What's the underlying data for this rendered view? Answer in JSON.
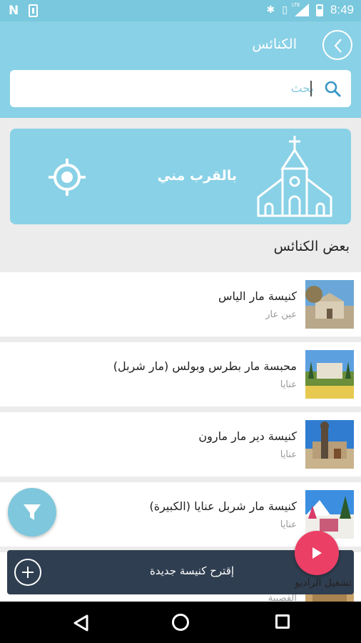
{
  "status_bar": {
    "left_icons": [
      "n-icon",
      "download-box-icon"
    ],
    "right_icons": [
      "bluetooth-icon",
      "vibrate-icon",
      "lte-signal-icon",
      "battery-icon"
    ],
    "lte_label": "LTE",
    "time": "8:49"
  },
  "header": {
    "title": "الكنائس",
    "back_icon": "chevron-right-icon",
    "search": {
      "placeholder": "بحث",
      "icon": "search-icon"
    }
  },
  "near_me": {
    "label": "بالقرب مني",
    "locate_icon": "crosshair-icon",
    "church_icon": "church-icon"
  },
  "section_title": "بعض الكنائس",
  "churches": [
    {
      "name": "كنيسة مار الياس",
      "location": "عين عار"
    },
    {
      "name": "محبسة مار بطرس وبولس (مار شربل)",
      "location": "عنايا"
    },
    {
      "name": "كنيسة دير مار مارون",
      "location": "عنايا"
    },
    {
      "name": "كنيسة مار شربل عنايا (الكبيرة)",
      "location": "عنايا"
    }
  ],
  "peek_item_location": "القصيبة",
  "filter_icon": "filter-icon",
  "suggest": {
    "label": "إقترح كنيسة جديدة",
    "icon": "add-circle-icon"
  },
  "radio": {
    "label": "تشغيل الراديو",
    "icon": "play-icon"
  },
  "colors": {
    "header": "#89d1e6",
    "status_bar": "#79c8dd",
    "suggest_bar": "#2f3e50",
    "radio_button": "#ec3f66",
    "background": "#ececec"
  },
  "nav_bar": [
    "back-icon",
    "home-icon",
    "recents-icon"
  ]
}
